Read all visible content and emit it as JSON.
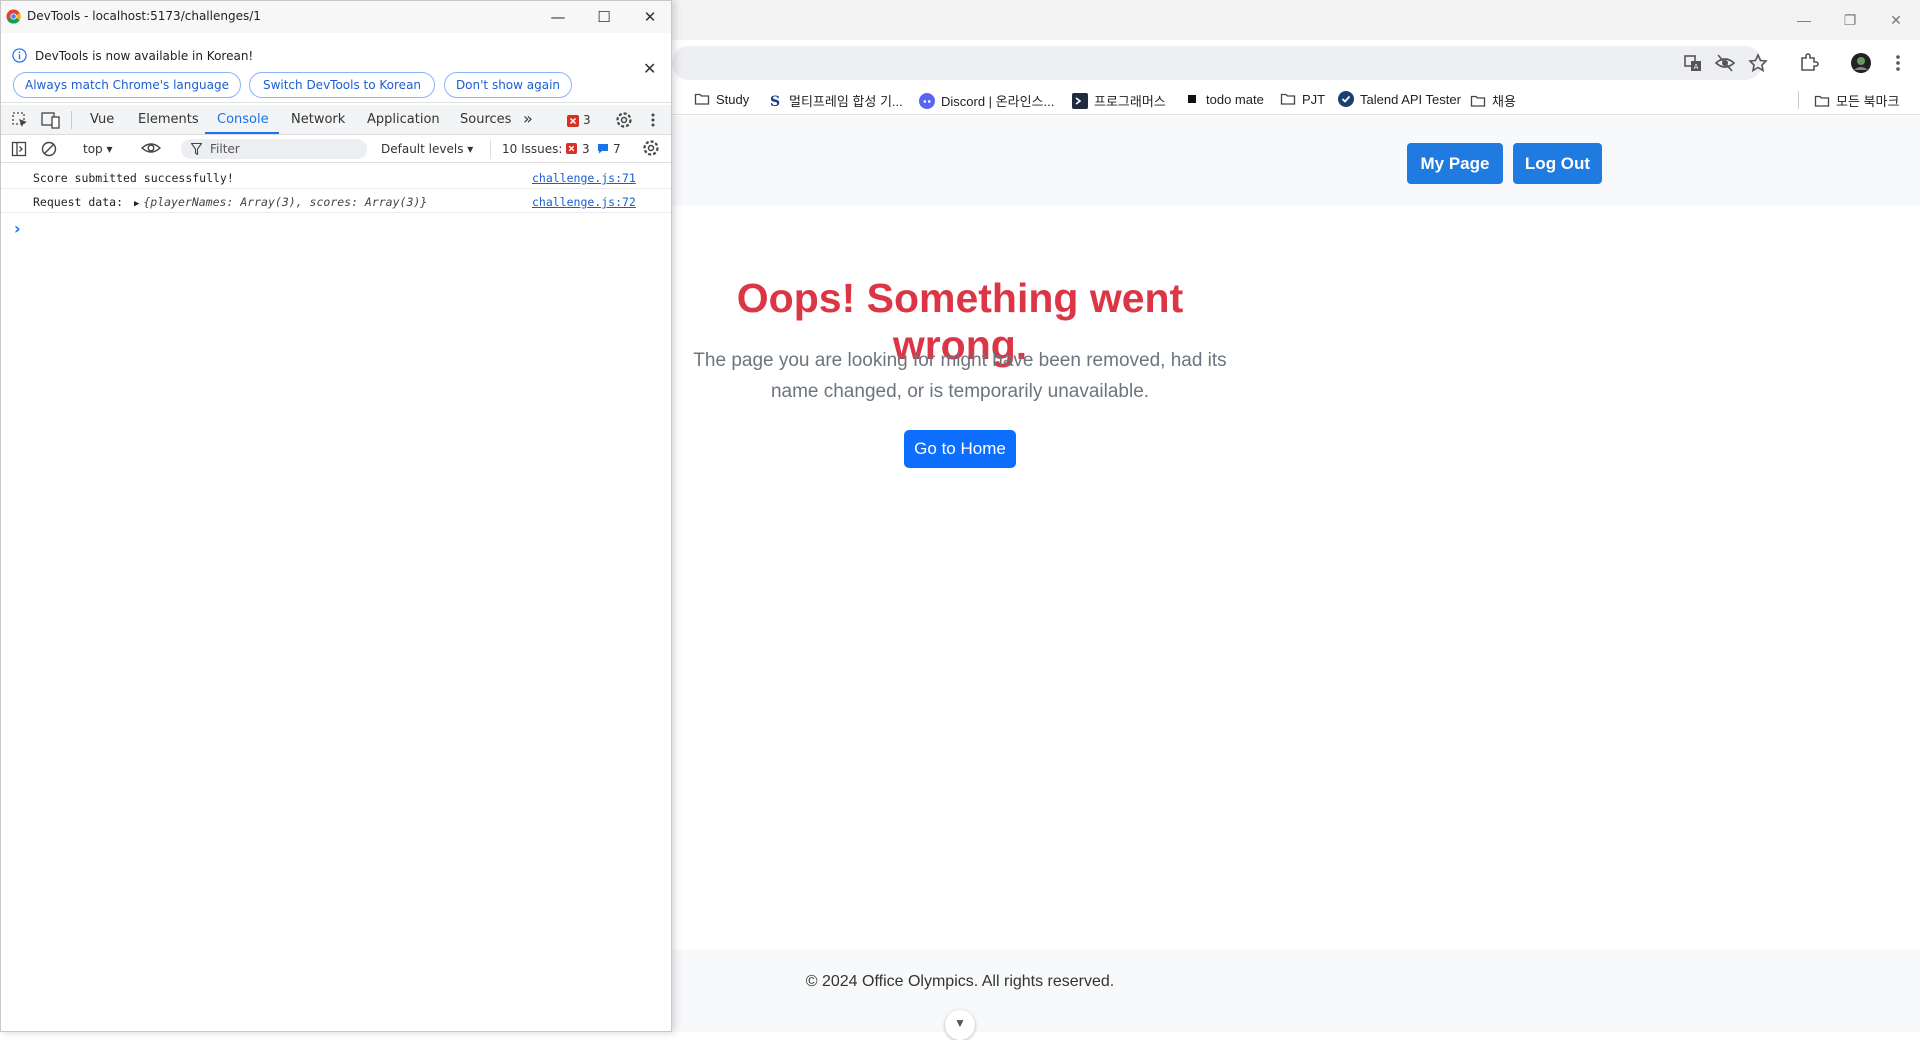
{
  "browser": {
    "bookmarks": [
      {
        "label": "Study",
        "icon": "folder-icon"
      },
      {
        "label": "멀티프레임 합성 기...",
        "icon": "s-logo-icon"
      },
      {
        "label": "Discord | 온라인스...",
        "icon": "discord-icon"
      },
      {
        "label": "프로그래머스",
        "icon": "programmers-icon"
      },
      {
        "label": "todo mate",
        "icon": "todo-icon"
      },
      {
        "label": "PJT",
        "icon": "folder-icon"
      },
      {
        "label": "Talend API Tester",
        "icon": "talend-icon"
      },
      {
        "label": "채용",
        "icon": "folder-icon"
      },
      {
        "label": "모든 북마크",
        "icon": "folder-icon"
      }
    ]
  },
  "page": {
    "header": {
      "my_page": "My Page",
      "log_out": "Log Out"
    },
    "error_title": "Oops! Something went wrong.",
    "error_text": "The page you are looking for might have been removed, had its name changed, or is temporarily unavailable.",
    "home_button": "Go to Home",
    "footer": "© 2024 Office Olympics. All rights reserved."
  },
  "devtools": {
    "title": "DevTools - localhost:5173/challenges/1",
    "banner": "DevTools is now available in Korean!",
    "banner_buttons": {
      "match": "Always match Chrome's language",
      "switch": "Switch DevTools to Korean",
      "dismiss": "Don't show again"
    },
    "tabs": [
      "Vue",
      "Elements",
      "Console",
      "Network",
      "Application",
      "Sources"
    ],
    "active_tab": "Console",
    "error_count": "3",
    "context": "top",
    "filter_placeholder": "Filter",
    "levels": "Default levels",
    "issues_label": "10 Issues:",
    "issues_errors": "3",
    "issues_info": "7",
    "logs": [
      {
        "text": "Score submitted successfully!",
        "source": "challenge.js:71"
      },
      {
        "text": "Request data: ",
        "object": "{playerNames: Array(3), scores: Array(3)}",
        "source": "challenge.js:72"
      }
    ],
    "prompt": "›"
  },
  "colors": {
    "error_red": "#dc3545",
    "primary_blue": "#0d6efd",
    "header_blue": "#1f7be0",
    "devtools_accent": "#1a73e8"
  }
}
